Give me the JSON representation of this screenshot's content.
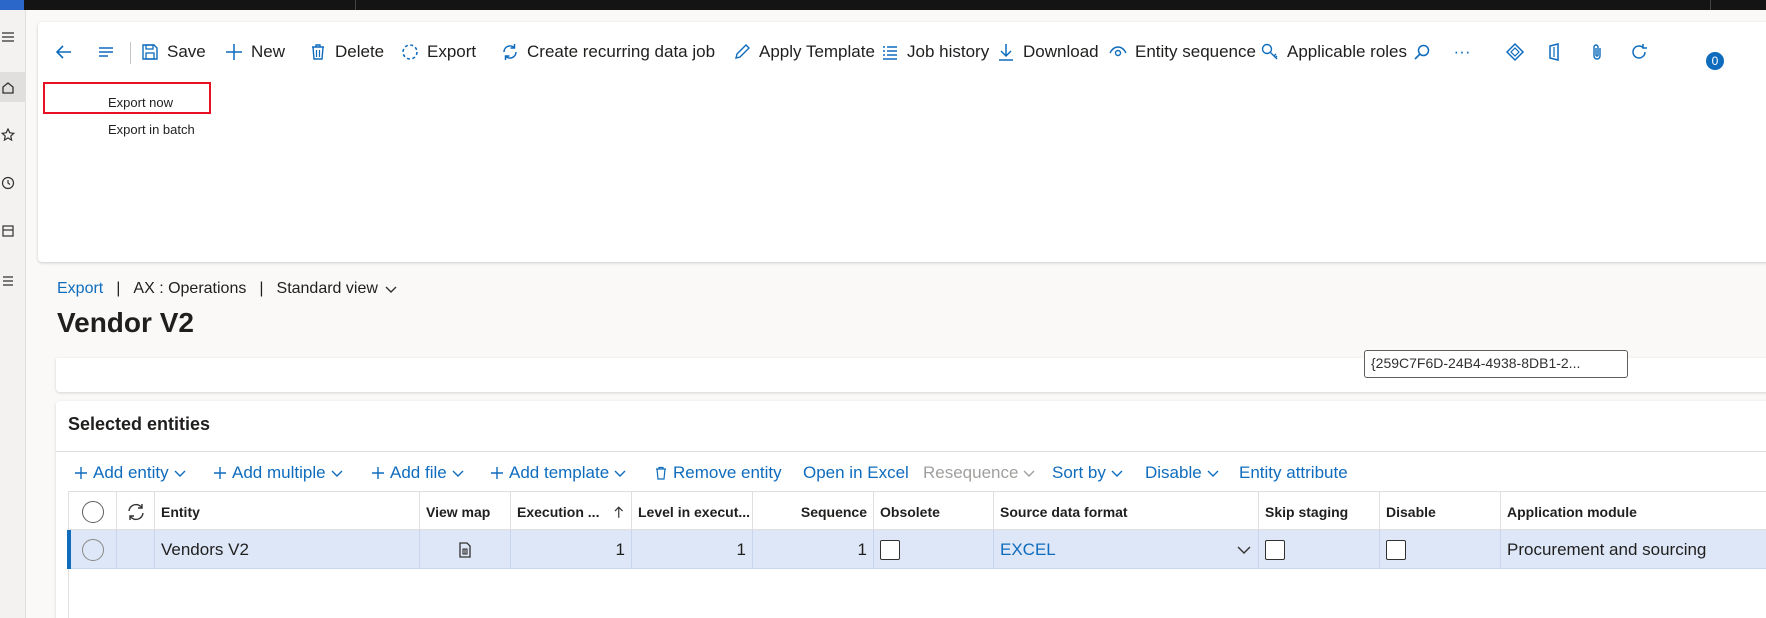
{
  "toolbar": {
    "save": "Save",
    "new": "New",
    "delete": "Delete",
    "export": "Export",
    "create_recurring": "Create recurring data job",
    "apply_template": "Apply Template",
    "job_history": "Job history",
    "download": "Download",
    "entity_sequence": "Entity sequence",
    "applicable_roles": "Applicable roles",
    "more": "···",
    "attachments_count": "0"
  },
  "export_menu": {
    "export_now": "Export now",
    "export_in_batch": "Export in batch"
  },
  "breadcrumb": {
    "link": "Export",
    "sep1": "|",
    "context": "AX : Operations",
    "sep2": "|",
    "view": "Standard view"
  },
  "page_title": "Vendor V2",
  "summary": {
    "guid": "{259C7F6D-24B4-4938-8DB1-2..."
  },
  "selected_entities": {
    "title": "Selected entities",
    "toolbar": {
      "add_entity": "Add entity",
      "add_multiple": "Add multiple",
      "add_file": "Add file",
      "add_template": "Add template",
      "remove_entity": "Remove entity",
      "open_in_excel": "Open in Excel",
      "resequence": "Resequence",
      "sort_by": "Sort by",
      "disable": "Disable",
      "entity_attribute": "Entity attribute"
    },
    "columns": {
      "entity": "Entity",
      "view_map": "View map",
      "execution_unit": "Execution ...",
      "level_in_execution": "Level in execut...",
      "sequence": "Sequence",
      "obsolete": "Obsolete",
      "source_data_format": "Source data format",
      "skip_staging": "Skip staging",
      "disable": "Disable",
      "application_module": "Application module"
    },
    "rows": [
      {
        "entity": "Vendors V2",
        "execution_unit": "1",
        "level_in_execution": "1",
        "sequence": "1",
        "source_data_format": "EXCEL",
        "application_module": "Procurement and sourcing"
      }
    ]
  },
  "colors": {
    "accent": "#0f6cbd",
    "selected_row": "#dde7f7",
    "highlight_box": "#e81123"
  }
}
